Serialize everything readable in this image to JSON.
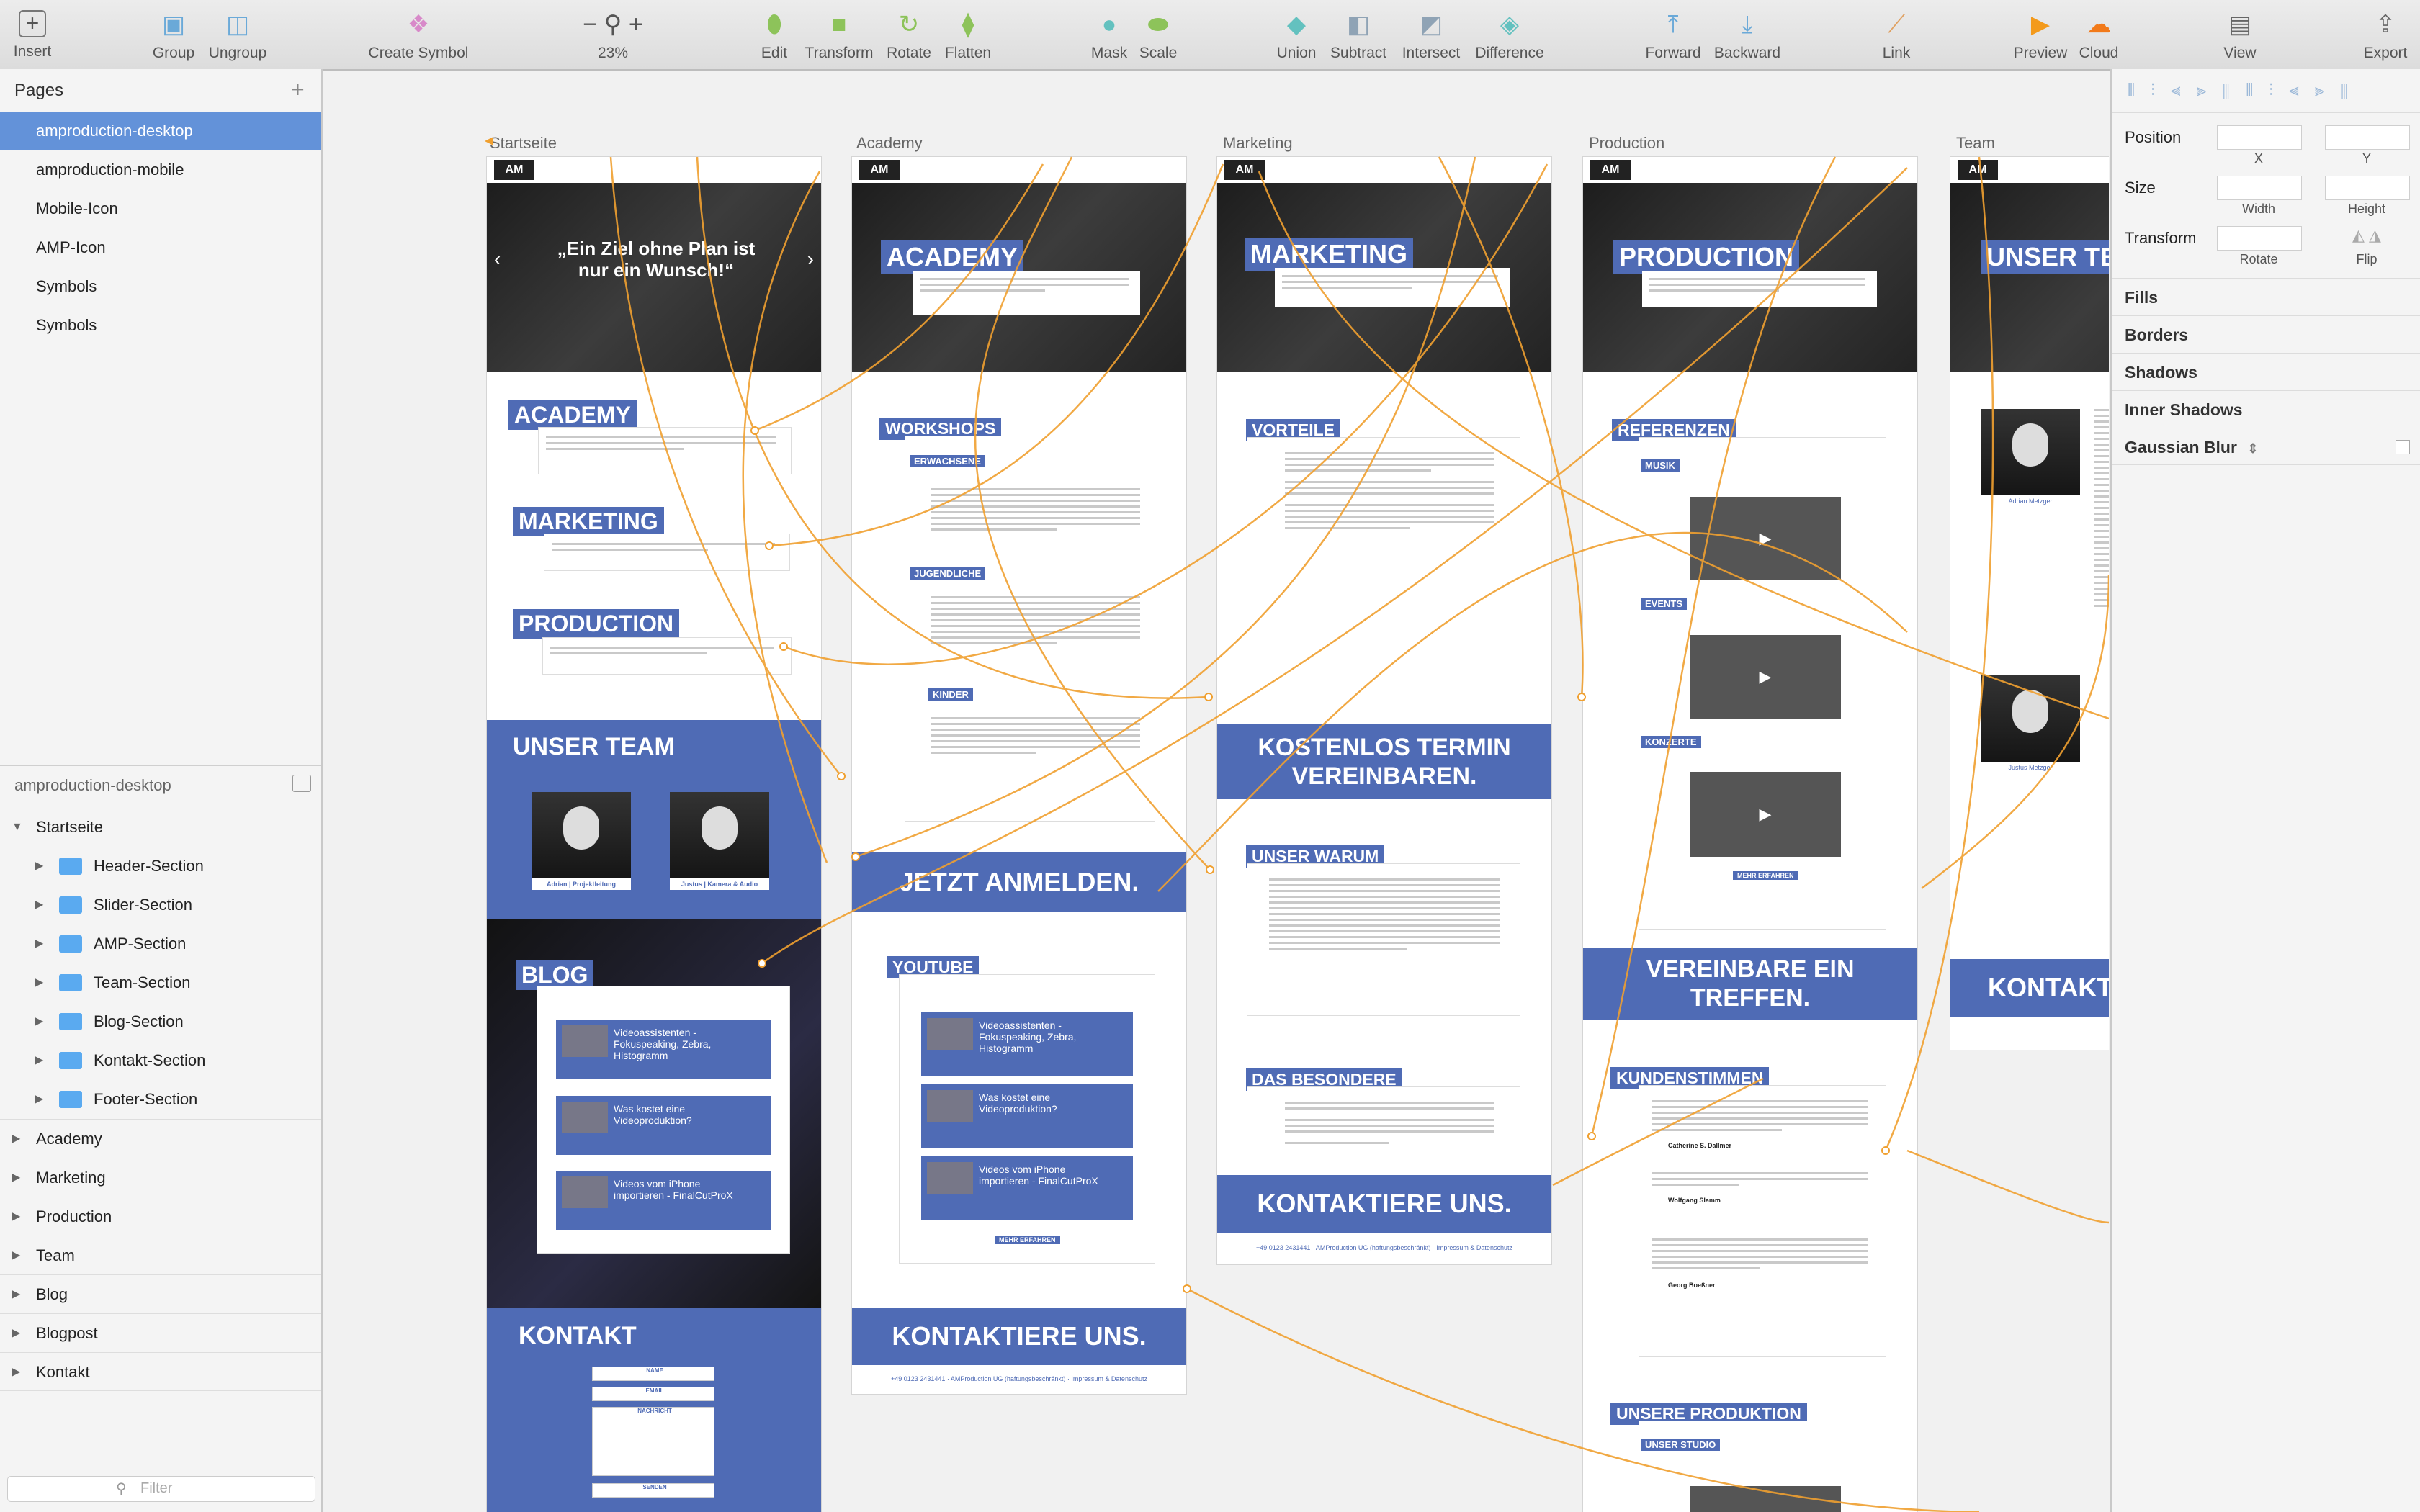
{
  "toolbar": {
    "insert": "Insert",
    "group": "Group",
    "ungroup": "Ungroup",
    "create_symbol": "Create Symbol",
    "zoom": "23%",
    "edit": "Edit",
    "transform": "Transform",
    "rotate": "Rotate",
    "flatten": "Flatten",
    "mask": "Mask",
    "scale": "Scale",
    "union": "Union",
    "subtract": "Subtract",
    "intersect": "Intersect",
    "difference": "Difference",
    "forward": "Forward",
    "backward": "Backward",
    "link": "Link",
    "preview": "Preview",
    "cloud": "Cloud",
    "view": "View",
    "export": "Export"
  },
  "pages": {
    "header": "Pages",
    "items": [
      "amproduction-desktop",
      "amproduction-mobile",
      "Mobile-Icon",
      "AMP-Icon",
      "Symbols",
      "Symbols"
    ],
    "selected_index": 0
  },
  "layers": {
    "header": "amproduction-desktop",
    "artboard": "Startseite",
    "groups": [
      "Header-Section",
      "Slider-Section",
      "AMP-Section",
      "Team-Section",
      "Blog-Section",
      "Kontakt-Section",
      "Footer-Section"
    ],
    "artboards": [
      "Academy",
      "Marketing",
      "Production",
      "Team",
      "Blog",
      "Blogpost",
      "Kontakt"
    ],
    "filter_placeholder": "Filter"
  },
  "inspector": {
    "position": "Position",
    "x": "X",
    "y": "Y",
    "size": "Size",
    "width": "Width",
    "height": "Height",
    "transform": "Transform",
    "rotate": "Rotate",
    "flip": "Flip",
    "fills": "Fills",
    "borders": "Borders",
    "shadows": "Shadows",
    "inner_shadows": "Inner Shadows",
    "gaussian_blur": "Gaussian Blur"
  },
  "artboards": {
    "startseite": {
      "title": "Startseite",
      "quote": "„Ein Ziel ohne Plan ist nur ein Wunsch!“",
      "academy": "ACADEMY",
      "marketing": "MARKETING",
      "production": "PRODUCTION",
      "team": "UNSER TEAM",
      "member1": "Adrian | Projektleitung",
      "member2": "Justus | Kamera & Audio",
      "blog": "BLOG",
      "posts": [
        "Videoassistenten - Fokuspeaking, Zebra, Histogramm",
        "Was kostet eine Videoproduktion?",
        "Videos vom iPhone importieren - FinalCutProX"
      ],
      "kontakt": "KONTAKT",
      "name": "NAME",
      "email": "EMAIL",
      "nachricht": "NACHRICHT",
      "senden": "SENDEN"
    },
    "academy": {
      "title": "Academy",
      "hero": "ACADEMY",
      "workshops": "WORKSHOPS",
      "erwachsene": "ERWACHSENE",
      "jugendliche": "JUGENDLICHE",
      "kinder": "KINDER",
      "cta": "JETZT ANMELDEN.",
      "youtube": "YOUTUBE",
      "posts": [
        "Videoassistenten - Fokuspeaking, Zebra, Histogramm",
        "Was kostet eine Videoproduktion?",
        "Videos vom iPhone importieren - FinalCutProX"
      ],
      "more": "MEHR ERFAHREN",
      "contact": "KONTAKTIERE UNS.",
      "footer": "+49 0123 2431441 · AMProduction UG (haftungsbeschränkt) · Impressum & Datenschutz"
    },
    "marketing": {
      "title": "Marketing",
      "hero": "MARKETING",
      "vorteile": "VORTEILE",
      "cta": "KOSTENLOS TERMIN VEREINBAREN.",
      "warum": "UNSER WARUM",
      "besondere": "DAS BESONDERE",
      "contact": "KONTAKTIERE UNS.",
      "footer": "+49 0123 2431441 · AMProduction UG (haftungsbeschränkt) · Impressum & Datenschutz"
    },
    "production": {
      "title": "Production",
      "hero": "PRODUCTION",
      "referenzen": "REFERENZEN",
      "musik": "MUSIK",
      "events": "EVENTS",
      "konzerte": "KONZERTE",
      "more": "MEHR ERFAHREN",
      "cta": "VEREINBARE EIN TREFFEN.",
      "kundenstimmen": "KUNDENSTIMMEN",
      "names": [
        "Catherine S. Dallmer",
        "Wolfgang Slamm",
        "Georg Boeßner"
      ],
      "produktion": "UNSERE PRODUKTION",
      "studio": "UNSER STUDIO"
    },
    "team": {
      "title": "Team",
      "hero": "UNSER TE",
      "member1": "Adrian Metzger",
      "member2": "Justus Metzger",
      "contact": "KONTAKT"
    }
  },
  "colors": {
    "accent": "#4f6bb5",
    "selection": "#6392d9",
    "link_lines": "#f0a030"
  }
}
